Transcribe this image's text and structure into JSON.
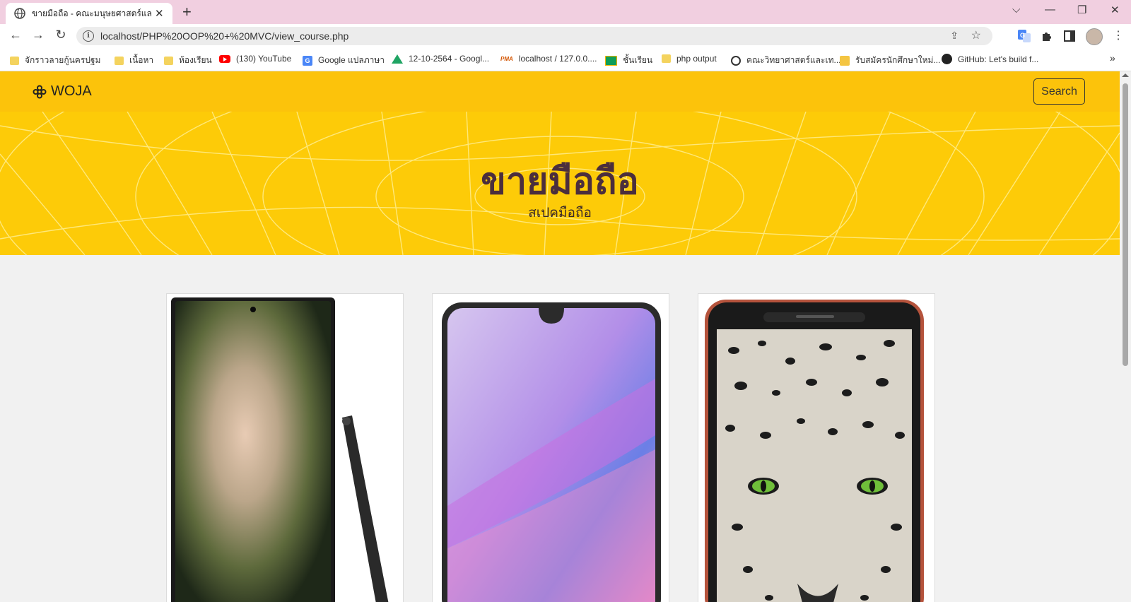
{
  "browser": {
    "tab_title": "ขายมือถือ - คณะมนุษยศาสตร์และสังคมศาสตร์",
    "url": "localhost/PHP%20OOP%20+%20MVC/view_course.php",
    "bookmarks": [
      {
        "icon": "folder-icon",
        "label": "จักราวลายกู้นครปฐม"
      },
      {
        "icon": "folder-icon",
        "label": "เนื้อหา"
      },
      {
        "icon": "folder-icon",
        "label": "ห้องเรียน"
      },
      {
        "icon": "youtube-icon",
        "label": "(130) YouTube"
      },
      {
        "icon": "google-translate-icon",
        "label": "Google แปลภาษา"
      },
      {
        "icon": "google-drive-icon",
        "label": "12-10-2564 - Googl..."
      },
      {
        "icon": "phpmyadmin-icon",
        "label": "localhost / 127.0.0...."
      },
      {
        "icon": "classroom-icon",
        "label": "ชั้นเรียน"
      },
      {
        "icon": "folder-icon",
        "label": "php output"
      },
      {
        "icon": "globe-icon",
        "label": "คณะวิทยาศาสตร์และเท..."
      },
      {
        "icon": "university-icon",
        "label": "รับสมัครนักศึกษาใหม่..."
      },
      {
        "icon": "github-icon",
        "label": "GitHub: Let's build f..."
      }
    ]
  },
  "site": {
    "brand": "WOJA",
    "search_label": "Search",
    "hero_title": "ขายมือถือ",
    "hero_subtitle": "สเปคมือถือ"
  },
  "products": [
    {
      "image": "phone-green-with-stylus"
    },
    {
      "image": "phone-purple-wallpaper"
    },
    {
      "image": "phone-leopard-wallpaper"
    }
  ],
  "colors": {
    "nav_bg": "#fcc30b",
    "hero_bg": "#fdcb08",
    "hero_title": "#4b2e3d",
    "tab_strip": "#f1cfe0"
  }
}
